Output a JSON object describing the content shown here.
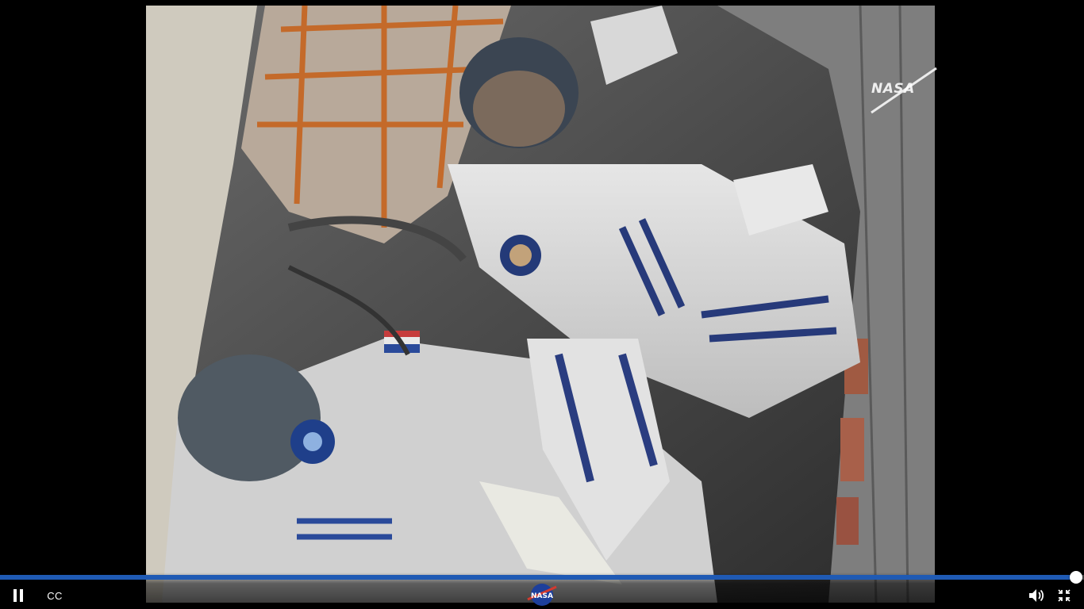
{
  "player": {
    "watermark": {
      "text": "NASA",
      "icon": "nasa-meatball-logo"
    },
    "progress": {
      "played_fraction": 0.993,
      "color": "#1f5ab4"
    },
    "controls": {
      "pause": {
        "icon": "pause-icon"
      },
      "captions": {
        "label": "CC"
      },
      "logo": {
        "icon": "nasa-logo-icon"
      },
      "volume": {
        "icon": "volume-icon"
      },
      "exit_fullscreen": {
        "icon": "exit-fullscreen-icon"
      }
    }
  }
}
